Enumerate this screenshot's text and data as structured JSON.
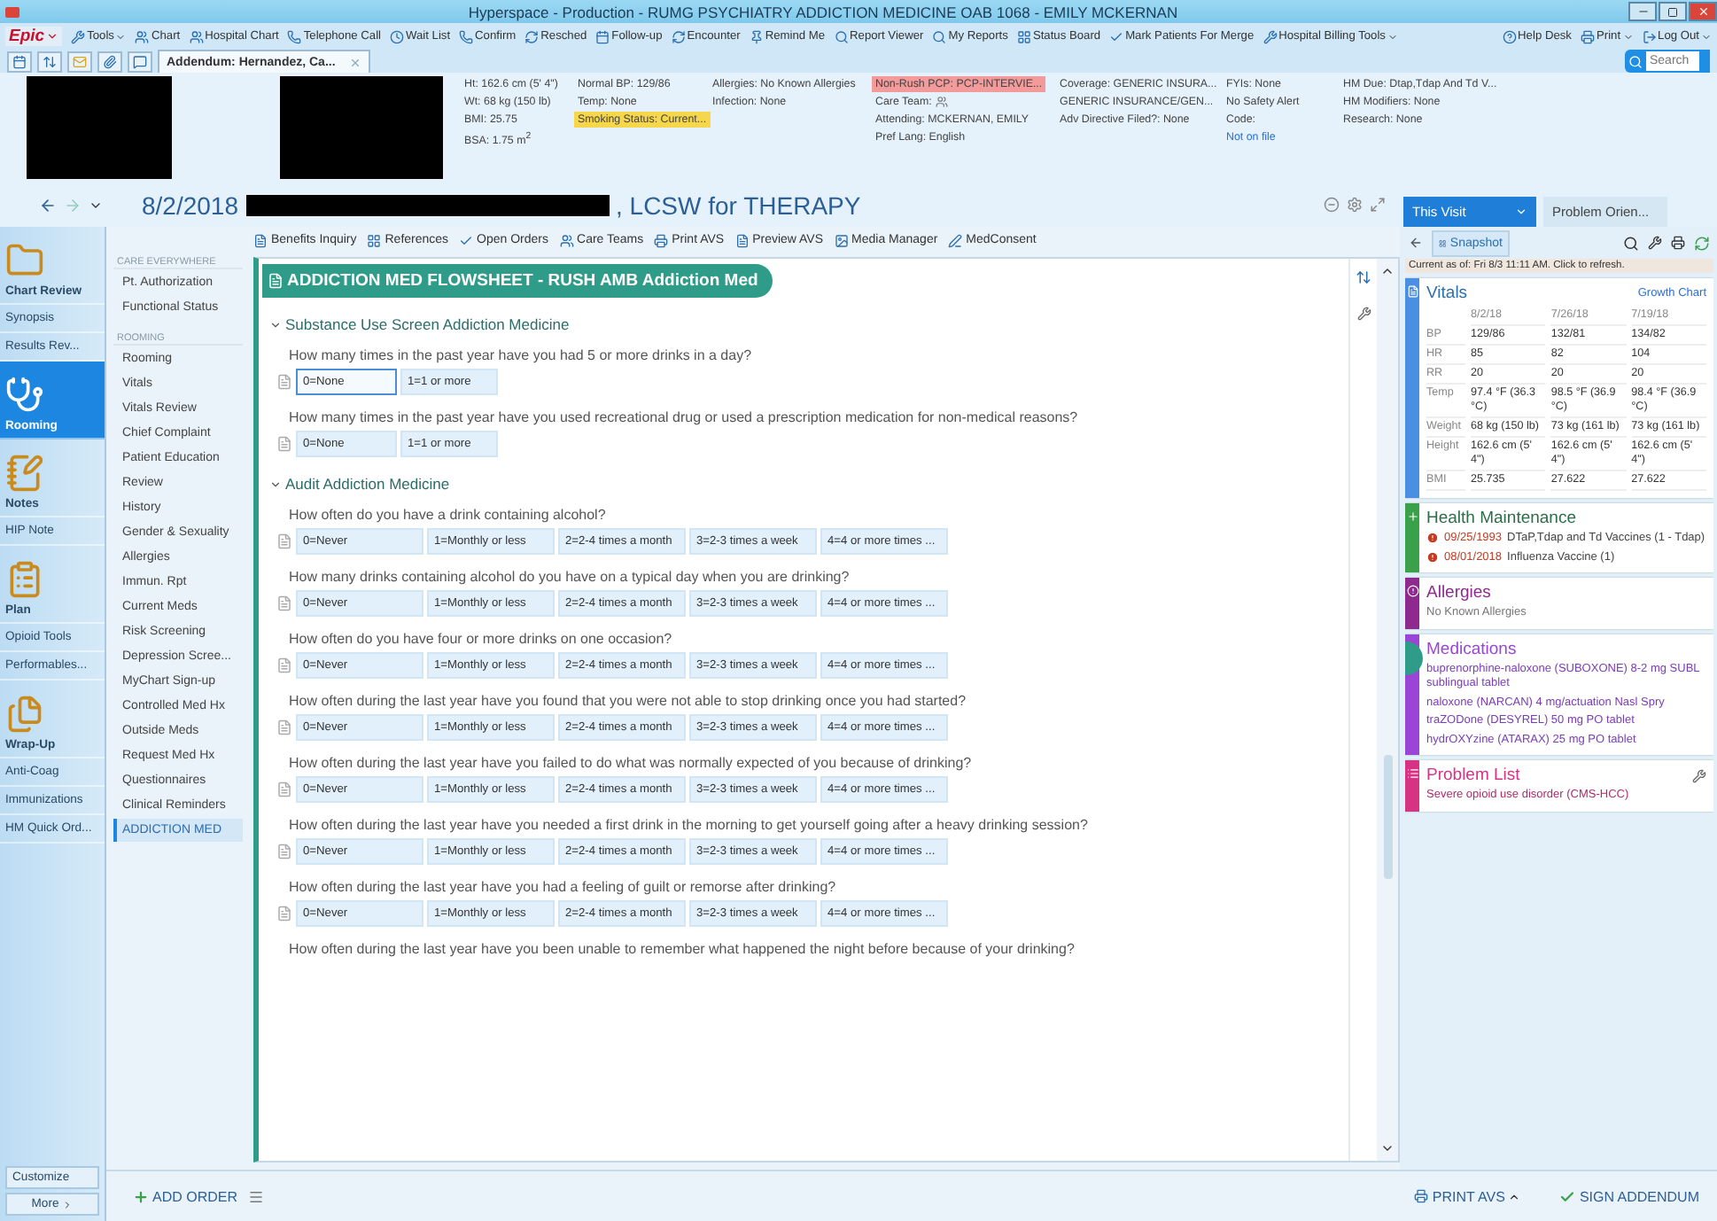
{
  "window": {
    "title": "Hyperspace - Production - RUMG PSYCHIATRY ADDICTION MEDICINE OAB 1068 - EMILY MCKERNAN"
  },
  "menu": {
    "brand": "Epic",
    "items": [
      {
        "label": "Tools",
        "dropdown": true
      },
      {
        "label": "Chart",
        "dropdown": false
      },
      {
        "label": "Hospital Chart",
        "dropdown": false
      },
      {
        "label": "Telephone Call",
        "dropdown": false
      },
      {
        "label": "Wait List",
        "dropdown": false
      },
      {
        "label": "Confirm",
        "dropdown": false
      },
      {
        "label": "Resched",
        "dropdown": false
      },
      {
        "label": "Follow-up",
        "dropdown": false
      },
      {
        "label": "Encounter",
        "dropdown": false
      },
      {
        "label": "Remind Me",
        "dropdown": false
      },
      {
        "label": "Report Viewer",
        "dropdown": false
      },
      {
        "label": "My Reports",
        "dropdown": false
      },
      {
        "label": "Status Board",
        "dropdown": false
      },
      {
        "label": "Mark Patients For Merge",
        "dropdown": false
      },
      {
        "label": "Hospital Billing Tools",
        "dropdown": true
      }
    ],
    "right": [
      {
        "label": "Help Desk",
        "dropdown": false
      },
      {
        "label": "Print",
        "dropdown": true
      },
      {
        "label": "Log Out",
        "dropdown": true
      }
    ]
  },
  "tab": {
    "label": "Addendum: Hernandez, Ca..."
  },
  "search": {
    "placeholder": "Search"
  },
  "header": {
    "columns": [
      [
        {
          "text": "Ht: 162.6 cm (5' 4\")",
          "kind": "plain"
        },
        {
          "text": "Wt: 68 kg (150 lb)",
          "kind": "plain"
        },
        {
          "text": "BMI: 25.75",
          "kind": "plain"
        },
        {
          "text": "BSA: 1.75 m$^{2}$",
          "kind": "plain"
        }
      ],
      [
        {
          "text": "Normal BP: 129/86",
          "kind": "plain"
        },
        {
          "text": "Temp: None",
          "kind": "plain"
        },
        {
          "text": "Smoking Status: Current...",
          "kind": "warning"
        }
      ],
      [
        {
          "text": "Allergies: No Known Allergies",
          "kind": "plain"
        },
        {
          "text": "Infection: None",
          "kind": "plain"
        }
      ],
      [
        {
          "text": "Non-Rush PCP: PCP-INTERVIE...",
          "kind": "alert"
        },
        {
          "text": "Care Team:",
          "kind": "team"
        },
        {
          "text": "Attending: MCKERNAN, EMILY",
          "kind": "plain"
        },
        {
          "text": "Pref Lang: English",
          "kind": "plain"
        }
      ],
      [
        {
          "text": "Coverage: GENERIC INSURA...",
          "kind": "plain"
        },
        {
          "text": "GENERIC INSURANCE/GEN...",
          "kind": "plain"
        },
        {
          "text": "Adv Directive Filed?: None",
          "kind": "plain"
        }
      ],
      [
        {
          "text": "FYIs: None",
          "kind": "plain"
        },
        {
          "text": "No Safety Alert",
          "kind": "plain"
        },
        {
          "text": "Code:",
          "kind": "plain"
        },
        {
          "text": "Not on file",
          "kind": "link"
        }
      ],
      [
        {
          "text": "HM Due: Dtap,Tdap And Td V...",
          "kind": "plain"
        },
        {
          "text": "HM Modifiers: None",
          "kind": "plain"
        },
        {
          "text": "Research: None",
          "kind": "plain"
        }
      ]
    ]
  },
  "encounter": {
    "date": "8/2/2018",
    "provider": ", LCSW for THERAPY"
  },
  "sidebar": {
    "items": [
      {
        "label": "Chart Review",
        "kind": "major",
        "selected": false
      },
      {
        "label": "Synopsis",
        "kind": "minor",
        "selected": false
      },
      {
        "label": "Results Rev...",
        "kind": "minor",
        "selected": false
      },
      {
        "label": "Rooming",
        "kind": "major",
        "selected": true
      },
      {
        "label": "Notes",
        "kind": "major",
        "selected": false
      },
      {
        "label": "HIP Note",
        "kind": "minor",
        "selected": false
      },
      {
        "label": "Plan",
        "kind": "major",
        "selected": false
      },
      {
        "label": "Opioid Tools",
        "kind": "minor",
        "selected": false
      },
      {
        "label": "Performables...",
        "kind": "minor",
        "selected": false
      },
      {
        "label": "Wrap-Up",
        "kind": "major",
        "selected": false
      },
      {
        "label": "Anti-Coag",
        "kind": "minor",
        "selected": false
      },
      {
        "label": "Immunizations",
        "kind": "minor",
        "selected": false
      },
      {
        "label": "HM Quick Ord...",
        "kind": "minor",
        "selected": false
      }
    ],
    "customize": "Customize",
    "more": "More"
  },
  "activity_toolbar": [
    "Benefits Inquiry",
    "References",
    "Open Orders",
    "Care Teams",
    "Print AVS",
    "Preview AVS",
    "Media Manager",
    "MedConsent"
  ],
  "nav": {
    "sections": [
      {
        "heading": "CARE EVERYWHERE",
        "items": [
          {
            "label": "Pt. Authorization",
            "selected": false
          },
          {
            "label": "Functional Status",
            "selected": false
          }
        ]
      },
      {
        "heading": "ROOMING",
        "items": [
          {
            "label": "Rooming",
            "selected": false
          },
          {
            "label": "Vitals",
            "selected": false
          },
          {
            "label": "Vitals Review",
            "selected": false
          },
          {
            "label": "Chief Complaint",
            "selected": false
          },
          {
            "label": "Patient Education",
            "selected": false
          },
          {
            "label": "Review",
            "selected": false
          },
          {
            "label": "History",
            "selected": false
          },
          {
            "label": "Gender & Sexuality",
            "selected": false
          },
          {
            "label": "Allergies",
            "selected": false
          },
          {
            "label": "Immun. Rpt",
            "selected": false
          },
          {
            "label": "Current Meds",
            "selected": false
          },
          {
            "label": "Risk Screening",
            "selected": false
          },
          {
            "label": "Depression Scree...",
            "selected": false
          },
          {
            "label": "MyChart Sign-up",
            "selected": false
          },
          {
            "label": "Controlled Med Hx",
            "selected": false
          },
          {
            "label": "Outside Meds",
            "selected": false
          },
          {
            "label": "Request Med Hx",
            "selected": false
          },
          {
            "label": "Questionnaires",
            "selected": false
          },
          {
            "label": "Clinical Reminders",
            "selected": false
          },
          {
            "label": "ADDICTION MED",
            "selected": true
          }
        ]
      }
    ]
  },
  "flowsheet": {
    "title": "ADDICTION MED FLOWSHEET - RUSH AMB Addiction Med",
    "sections": [
      {
        "title": "Substance Use Screen Addiction Medicine",
        "expanded": true,
        "questions": [
          {
            "text": "How many times in the past year have you had 5 or more drinks in a day?",
            "options": [
              {
                "label": "0=None",
                "selected": true
              },
              {
                "label": "1=1 or more",
                "selected": false
              }
            ]
          },
          {
            "text": "How many times in the past year have you used recreational drug or used a prescription medication for non-medical reasons?",
            "options": [
              {
                "label": "0=None",
                "selected": false
              },
              {
                "label": "1=1 or more",
                "selected": false
              }
            ]
          }
        ]
      },
      {
        "title": "Audit Addiction Medicine",
        "expanded": true,
        "questions": [
          {
            "text": "How often do you have a drink containing alcohol?",
            "options": [
              {
                "label": "0=Never",
                "selected": false
              },
              {
                "label": "1=Monthly or less",
                "selected": false
              },
              {
                "label": "2=2-4 times a month",
                "selected": false
              },
              {
                "label": "3=2-3 times a week",
                "selected": false
              },
              {
                "label": "4=4 or more times ...",
                "selected": false
              }
            ]
          },
          {
            "text": "How many drinks containing alcohol do you have on a typical day when you are drinking?",
            "options": [
              {
                "label": "0=Never",
                "selected": false
              },
              {
                "label": "1=Monthly or less",
                "selected": false
              },
              {
                "label": "2=2-4 times a month",
                "selected": false
              },
              {
                "label": "3=2-3 times a week",
                "selected": false
              },
              {
                "label": "4=4 or more times ...",
                "selected": false
              }
            ]
          },
          {
            "text": "How often do you have four or more drinks on one occasion?",
            "options": [
              {
                "label": "0=Never",
                "selected": false
              },
              {
                "label": "1=Monthly or less",
                "selected": false
              },
              {
                "label": "2=2-4 times a month",
                "selected": false
              },
              {
                "label": "3=2-3 times a week",
                "selected": false
              },
              {
                "label": "4=4 or more times ...",
                "selected": false
              }
            ]
          },
          {
            "text": "How often during the last year have you found that you were not able to stop drinking once you had started?",
            "options": [
              {
                "label": "0=Never",
                "selected": false
              },
              {
                "label": "1=Monthly or less",
                "selected": false
              },
              {
                "label": "2=2-4 times a month",
                "selected": false
              },
              {
                "label": "3=2-3 times a week",
                "selected": false
              },
              {
                "label": "4=4 or more times ...",
                "selected": false
              }
            ]
          },
          {
            "text": "How often during the last year have you failed to do what was normally expected of you because of drinking?",
            "options": [
              {
                "label": "0=Never",
                "selected": false
              },
              {
                "label": "1=Monthly or less",
                "selected": false
              },
              {
                "label": "2=2-4 times a month",
                "selected": false
              },
              {
                "label": "3=2-3 times a week",
                "selected": false
              },
              {
                "label": "4=4 or more times ...",
                "selected": false
              }
            ]
          },
          {
            "text": "How often during the last year have you needed a first drink in the morning to get yourself going after a heavy drinking session?",
            "options": [
              {
                "label": "0=Never",
                "selected": false
              },
              {
                "label": "1=Monthly or less",
                "selected": false
              },
              {
                "label": "2=2-4 times a month",
                "selected": false
              },
              {
                "label": "3=2-3 times a week",
                "selected": false
              },
              {
                "label": "4=4 or more times ...",
                "selected": false
              }
            ]
          },
          {
            "text": "How often during the last year have you had a feeling of guilt or remorse after drinking?",
            "options": [
              {
                "label": "0=Never",
                "selected": false
              },
              {
                "label": "1=Monthly or less",
                "selected": false
              },
              {
                "label": "2=2-4 times a month",
                "selected": false
              },
              {
                "label": "3=2-3 times a week",
                "selected": false
              },
              {
                "label": "4=4 or more times ...",
                "selected": false
              }
            ]
          },
          {
            "text": "How often during the last year have you been unable to remember what happened the night before because of your drinking?"
          }
        ]
      }
    ]
  },
  "right_panel": {
    "tabs": [
      {
        "label": "This Visit",
        "selected": true
      },
      {
        "label": "Problem Orien...",
        "selected": false
      }
    ],
    "snapshot": "Snapshot",
    "refresh_note": "Current as of: Fri 8/3 11:11 AM. Click to refresh.",
    "vitals": {
      "title": "Vitals",
      "color": "#4a90e2",
      "link": "Growth Chart",
      "dates": [
        "8/2/18",
        "7/26/18",
        "7/19/18"
      ],
      "rows": [
        {
          "label": "BP",
          "values": [
            "129/86",
            "132/81",
            "134/82"
          ]
        },
        {
          "label": "HR",
          "values": [
            "85",
            "82",
            "104"
          ]
        },
        {
          "label": "RR",
          "values": [
            "20",
            "20",
            "20"
          ]
        },
        {
          "label": "Temp",
          "values": [
            "97.4 °F (36.3 °C)",
            "98.5 °F (36.9 °C)",
            "98.4 °F (36.9 °C)"
          ]
        },
        {
          "label": "Weight",
          "values": [
            "68 kg (150 lb)",
            "73 kg (161 lb)",
            "73 kg (161 lb)"
          ]
        },
        {
          "label": "Height",
          "values": [
            "162.6 cm (5' 4\")",
            "162.6 cm (5' 4\")",
            "162.6 cm (5' 4\")"
          ]
        },
        {
          "label": "BMI",
          "values": [
            "25.735",
            "27.622",
            "27.622"
          ]
        }
      ]
    },
    "cards": [
      {
        "title": "Health Maintenance",
        "kind": "maintenance",
        "color": "#3aa04a",
        "items": [
          {
            "date": "09/25/1993",
            "text": "DTaP,Tdap and Td Vaccines (1 - Tdap)"
          },
          {
            "date": "08/01/2018",
            "text": "Influenza Vaccine (1)"
          }
        ]
      },
      {
        "title": "Allergies",
        "kind": "allergies",
        "color": "#8e2a8e",
        "items": [
          {
            "text": "No Known Allergies"
          }
        ]
      },
      {
        "title": "Medications",
        "kind": "medications",
        "color": "#9b45d6",
        "items": [
          {
            "text": "buprenorphine-naloxone (SUBOXONE) 8-2 mg SUBL sublingual tablet"
          },
          {
            "text": "naloxone (NARCAN) 4 mg/actuation Nasl Spry"
          },
          {
            "text": "traZODone (DESYREL) 50 mg PO tablet"
          },
          {
            "text": "hydrOXYzine (ATARAX) 25 mg PO tablet"
          }
        ]
      },
      {
        "title": "Problem List",
        "kind": "problems",
        "color": "#d63384",
        "items": [
          {
            "text": "Severe opioid use disorder (CMS-HCC)"
          }
        ]
      }
    ]
  },
  "bottom": {
    "add_order": "ADD ORDER",
    "print_avs": "PRINT AVS",
    "sign": "SIGN ADDENDUM"
  }
}
